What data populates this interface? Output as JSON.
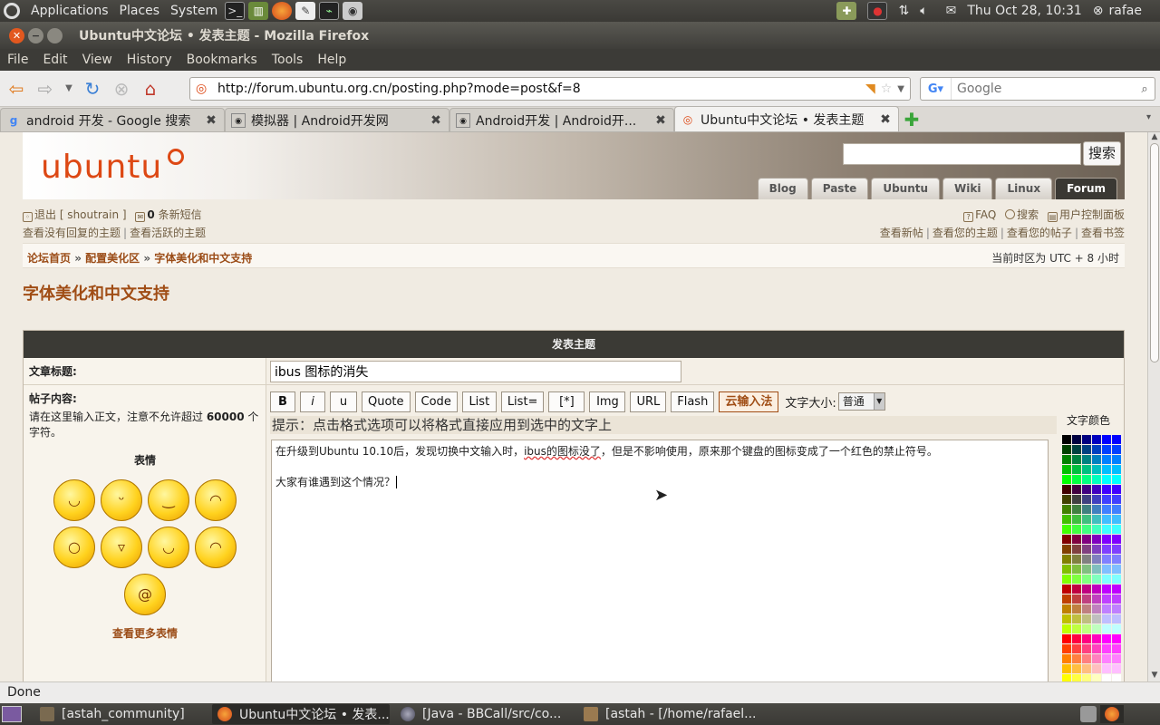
{
  "panel": {
    "menus": [
      "Applications",
      "Places",
      "System"
    ],
    "datetime": "Thu Oct 28, 10:31",
    "user": "rafae"
  },
  "window": {
    "title": "Ubuntu中文论坛 • 发表主题 - Mozilla Firefox"
  },
  "menubar": [
    "File",
    "Edit",
    "View",
    "History",
    "Bookmarks",
    "Tools",
    "Help"
  ],
  "nav": {
    "url": "http://forum.ubuntu.org.cn/posting.php?mode=post&f=8",
    "search_placeholder": "Google"
  },
  "tabs": [
    {
      "label": "android 开发 - Google 搜索"
    },
    {
      "label": "模拟器 | Android开发网"
    },
    {
      "label": "Android开发 | Android开..."
    },
    {
      "label": "Ubuntu中文论坛 • 发表主题"
    }
  ],
  "site": {
    "logo": "ubuntu",
    "search_button": "搜索",
    "tabs": [
      "Blog",
      "Paste",
      "Ubuntu",
      "Wiki",
      "Linux",
      "Forum"
    ]
  },
  "userbar": {
    "logout": "退出 [ shoutrain ]",
    "pm_count": "0",
    "pm_label": "条新短信",
    "unanswered": "查看没有回复的主题",
    "active": "查看活跃的主题",
    "faq": "FAQ",
    "search": "搜索",
    "ucp": "用户控制面板",
    "new_posts": "查看新帖",
    "your_topics": "查看您的主题",
    "your_posts": "查看您的帖子",
    "bookmarks": "查看书签"
  },
  "crumbs": {
    "home": "论坛首页",
    "cat": "配置美化区",
    "forum": "字体美化和中文支持",
    "timezone": "当前时区为 UTC + 8 小时"
  },
  "forum_title": "字体美化和中文支持",
  "post": {
    "header": "发表主题",
    "subject_label": "文章标题:",
    "subject_value": "ibus 图标的消失",
    "body_label": "帖子内容:",
    "body_note_pre": "请在这里输入正文，注意不允许超过 ",
    "body_limit": "60000",
    "body_note_post": " 个字符。",
    "smilies_title": "表情",
    "more_smilies": "查看更多表情",
    "buttons": [
      "B",
      "i",
      "u",
      "Quote",
      "Code",
      "List",
      "List=",
      "[*]",
      "Img",
      "URL",
      "Flash",
      "云输入法"
    ],
    "font_size_label": "文字大小:",
    "font_size_value": "普通",
    "hint": "提示：点击格式选项可以将格式直接应用到选中的文字上",
    "text_line1_pre": "在升级到Ubuntu 10.10后，发现切换中文输入时，",
    "text_line1_misspelled": "ibus的图标没了",
    "text_line1_post": "，但是不影响使用，原来那个键盘的图标变成了一个红色的禁止符号。",
    "text_line2": "大家有谁遇到这个情况？",
    "color_title": "文字颜色"
  },
  "status": "Done",
  "taskbar": [
    {
      "label": "[astah_community]"
    },
    {
      "label": "Ubuntu中文论坛 • 发表..."
    },
    {
      "label": "[Java - BBCall/src/co..."
    },
    {
      "label": "[astah - [/home/rafael..."
    }
  ]
}
